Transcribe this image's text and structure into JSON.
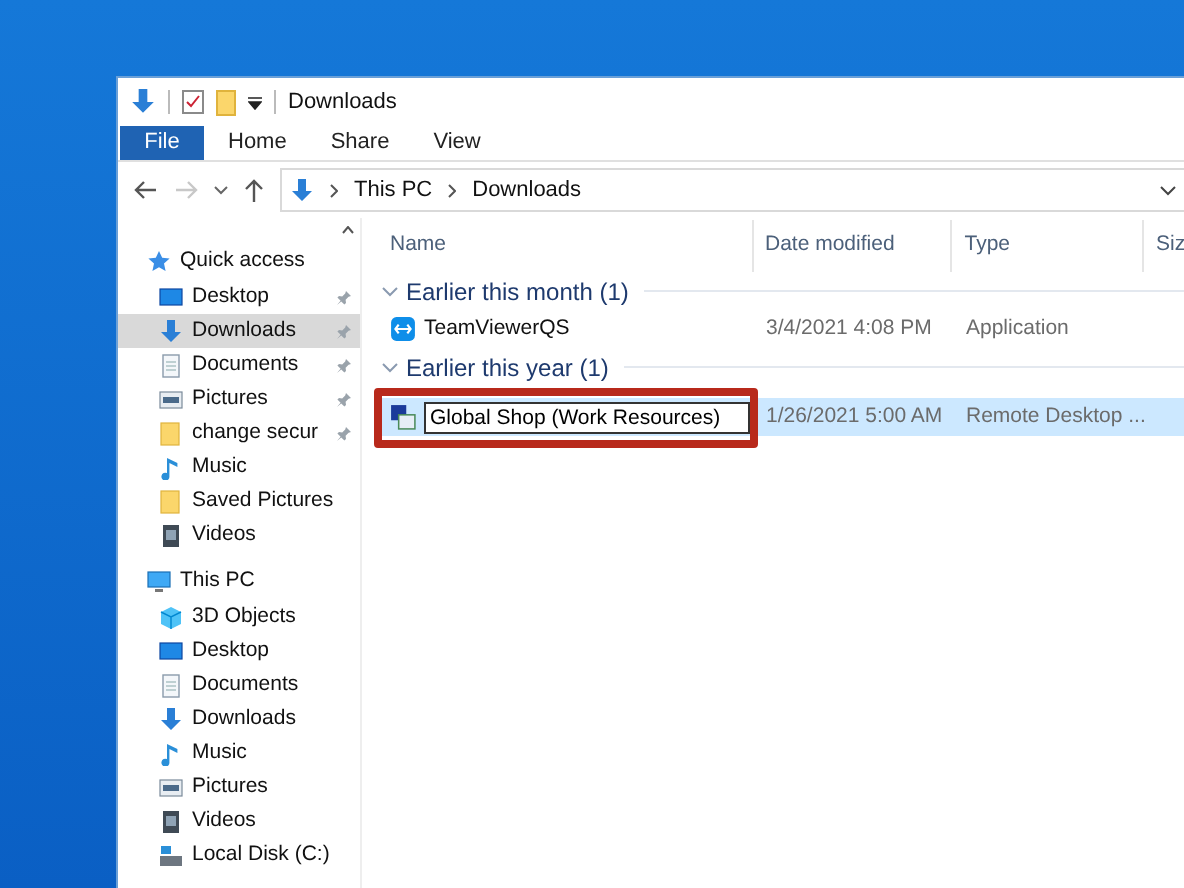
{
  "window": {
    "title": "Downloads"
  },
  "ribbon_tabs": [
    {
      "label": "File",
      "kind": "file"
    },
    {
      "label": "Home",
      "kind": "tab"
    },
    {
      "label": "Share",
      "kind": "tab"
    },
    {
      "label": "View",
      "kind": "tab"
    }
  ],
  "address": {
    "back_disabled": false,
    "forward_disabled": true,
    "path": [
      "This PC",
      "Downloads"
    ]
  },
  "nav": [
    {
      "label": "Quick access",
      "kind": "star",
      "selected": false,
      "children": [
        {
          "label": "Desktop",
          "kind": "desktop",
          "pinned": true,
          "selected": false
        },
        {
          "label": "Downloads",
          "kind": "downloads",
          "pinned": true,
          "selected": true
        },
        {
          "label": "Documents",
          "kind": "documents",
          "pinned": true,
          "selected": false
        },
        {
          "label": "Pictures",
          "kind": "pictures",
          "pinned": true,
          "selected": false
        },
        {
          "label": "change secur",
          "kind": "folder",
          "pinned": true,
          "selected": false
        },
        {
          "label": "Music",
          "kind": "music",
          "pinned": false,
          "selected": false
        },
        {
          "label": "Saved Pictures",
          "kind": "folder",
          "pinned": false,
          "selected": false
        },
        {
          "label": "Videos",
          "kind": "videos",
          "pinned": false,
          "selected": false
        }
      ]
    },
    {
      "label": "This PC",
      "kind": "pc",
      "selected": false,
      "children": [
        {
          "label": "3D Objects",
          "kind": "objects",
          "pinned": false,
          "selected": false
        },
        {
          "label": "Desktop",
          "kind": "desktop",
          "pinned": false,
          "selected": false
        },
        {
          "label": "Documents",
          "kind": "documents",
          "pinned": false,
          "selected": false
        },
        {
          "label": "Downloads",
          "kind": "downloads",
          "pinned": false,
          "selected": false
        },
        {
          "label": "Music",
          "kind": "music",
          "pinned": false,
          "selected": false
        },
        {
          "label": "Pictures",
          "kind": "pictures",
          "pinned": false,
          "selected": false
        },
        {
          "label": "Videos",
          "kind": "videos",
          "pinned": false,
          "selected": false
        },
        {
          "label": "Local Disk (C:)",
          "kind": "disk",
          "pinned": false,
          "selected": false
        }
      ]
    }
  ],
  "columns": [
    "Name",
    "Date modified",
    "Type",
    "Siz"
  ],
  "groups": [
    {
      "label": "Earlier this month (1)",
      "expanded": true,
      "rows": [
        {
          "name": "TeamViewerQS",
          "kind": "app",
          "date": "3/4/2021 4:08 PM",
          "type": "Application",
          "selected": false,
          "editing": false
        }
      ]
    },
    {
      "label": "Earlier this year (1)",
      "expanded": true,
      "rows": [
        {
          "name": "Global Shop (Work Resources)",
          "kind": "rdp",
          "date": "1/26/2021 5:00 AM",
          "type": "Remote Desktop ...",
          "selected": true,
          "editing": true
        }
      ]
    }
  ],
  "annotation": {
    "shown": true
  }
}
